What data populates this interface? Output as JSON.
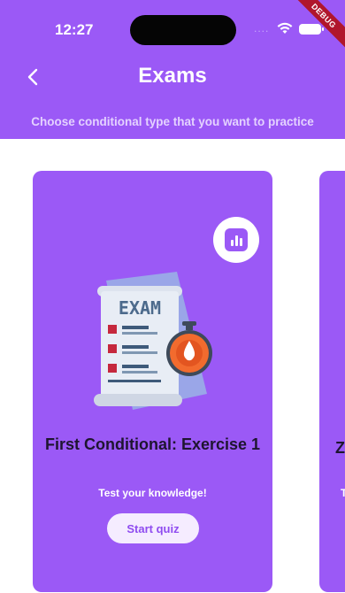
{
  "status_bar": {
    "time": "12:27",
    "signal": "....",
    "wifi_icon": "wifi-icon",
    "battery_icon": "battery-icon"
  },
  "debug_banner": "DEBUG",
  "header": {
    "back_icon": "chevron-left-icon",
    "title": "Exams",
    "subtitle": "Choose conditional type that you want to practice",
    "color": "#9b59f6"
  },
  "cards": [
    {
      "title": "First Conditional: Exercise 1",
      "description": "Test your knowledge!",
      "button_label": "Start quiz",
      "stats_icon": "bar-chart-icon",
      "illustration": "exam-stopwatch-illustration",
      "image_text": "EXAM"
    },
    {
      "title_partial": "Z",
      "description_partial": "T"
    }
  ],
  "colors": {
    "accent": "#9b59f6",
    "title_text": "#1e1530",
    "button_bg": "#f5ecff",
    "button_text": "#8f4cf0",
    "debug": "#b0162c"
  }
}
